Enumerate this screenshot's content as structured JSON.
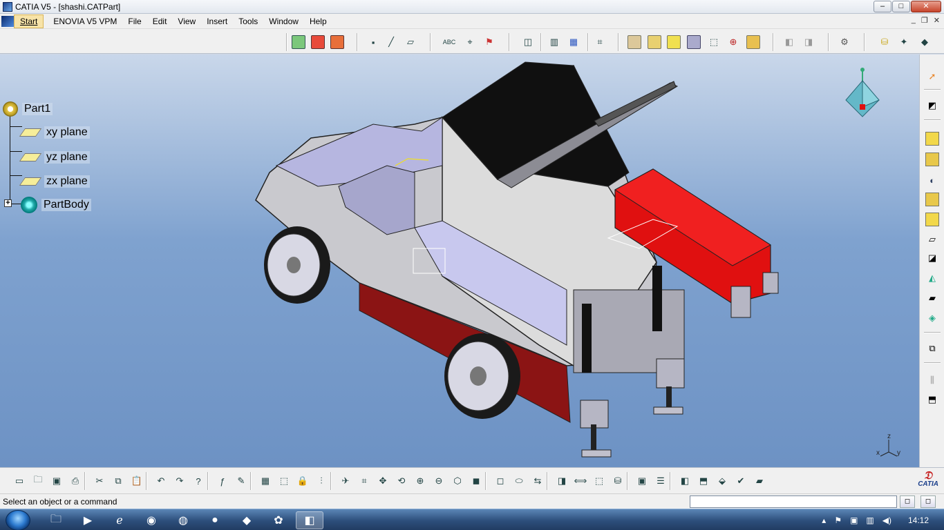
{
  "window": {
    "title": "CATIA V5 - [shashi.CATPart]",
    "min": "–",
    "max": "□",
    "close": "✕"
  },
  "menu": {
    "items": [
      "Start",
      "ENOVIA V5 VPM",
      "File",
      "Edit",
      "View",
      "Insert",
      "Tools",
      "Window",
      "Help"
    ]
  },
  "tree": {
    "root": "Part1",
    "planes": [
      "xy plane",
      "yz plane",
      "zx plane"
    ],
    "body": "PartBody"
  },
  "axis_labels": {
    "z": "z",
    "x": "x",
    "y": "y"
  },
  "bottom_logo": "CATIA",
  "status": {
    "message": "Select an object or a command",
    "command_value": ""
  },
  "taskbar": {
    "clock": "14:12"
  },
  "icons": {
    "top": [
      "sketch-icon",
      "sketcher-icon",
      "exit-icon",
      "point-icon",
      "line-icon",
      "plane-icon",
      "text-icon",
      "annotation-icon",
      "measure-icon",
      "hide-show-icon",
      "pattern-icon",
      "grid-icon",
      "fit-all-icon",
      "pad-icon",
      "pocket-icon",
      "shaft-icon",
      "groove-icon",
      "hole-icon",
      "rib-icon",
      "slot-icon",
      "apply-material-icon",
      "analysis-icon",
      "settings-icon",
      "catalog-icon",
      "publish-icon",
      "knowledge-icon"
    ],
    "right": [
      "select-icon",
      "sketch-tool-icon",
      "pad-icon",
      "pocket-icon",
      "shaft-icon",
      "groove-icon",
      "hole-icon",
      "fillet-icon",
      "chamfer-icon",
      "draft-icon",
      "shell-icon",
      "thickness-icon",
      "boolean-icon",
      "body-icon",
      "translate-icon"
    ],
    "bottom": [
      "new-icon",
      "open-icon",
      "save-icon",
      "print-icon",
      "cut-icon",
      "copy-icon",
      "paste-icon",
      "undo-icon",
      "redo-icon",
      "whats-this-icon",
      "formula-icon",
      "comment-icon",
      "table-icon",
      "tree-icon",
      "lock-icon",
      "tree-expand-icon",
      "fly-icon",
      "fit-all-icon",
      "pan-icon",
      "rotate-icon",
      "zoom-in-icon",
      "zoom-out-icon",
      "normal-view-icon",
      "iso-view-icon",
      "view-mode-icon",
      "hide-icon",
      "swap-icon",
      "render-icon",
      "measure-between-icon",
      "measure-item-icon",
      "inertia-icon",
      "capture-icon",
      "catalog-icon",
      "layers-icon",
      "update-icon",
      "material-icon",
      "check-icon",
      "knowledge-icon"
    ]
  },
  "colors": {
    "viewport_top": "#c9d7ea",
    "viewport_bottom": "#6d92c4",
    "accent_red": "#e01010"
  }
}
